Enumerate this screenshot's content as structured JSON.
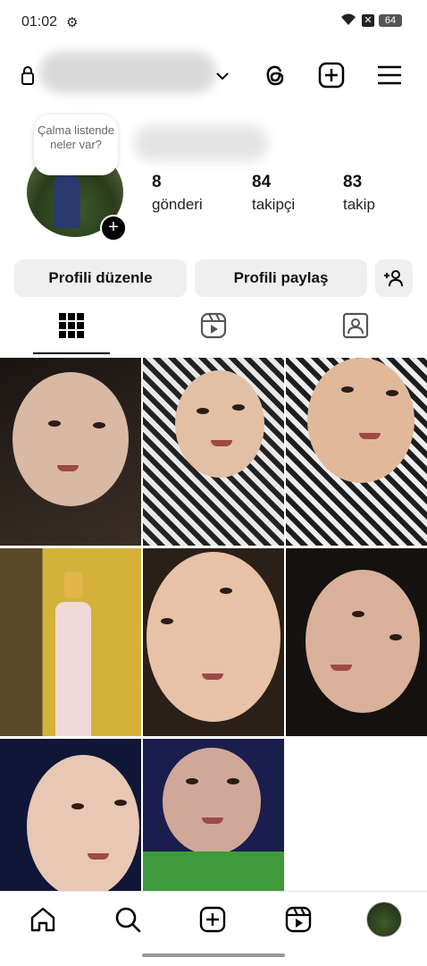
{
  "status_bar": {
    "time": "01:02",
    "battery": "64"
  },
  "header": {
    "username": ""
  },
  "profile": {
    "note": "Çalma listende neler var?",
    "stats": [
      {
        "value": "8",
        "label": "gönderi"
      },
      {
        "value": "84",
        "label": "takipçi"
      },
      {
        "value": "83",
        "label": "takip"
      }
    ]
  },
  "buttons": {
    "edit": "Profili düzenle",
    "share": "Profili paylaş"
  },
  "tabs": [
    "grid-icon",
    "reels-icon",
    "tagged-icon"
  ],
  "grid": {
    "post_count": 8
  },
  "nav": [
    "home-icon",
    "search-icon",
    "create-icon",
    "reels-icon",
    "profile-avatar"
  ]
}
